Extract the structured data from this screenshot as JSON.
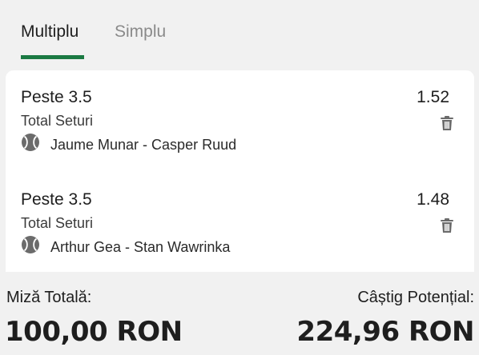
{
  "tabs": [
    {
      "label": "Multiplu",
      "active": true
    },
    {
      "label": "Simplu",
      "active": false
    }
  ],
  "colors": {
    "accent": "#1b7a43",
    "icon": "#6b6b6b"
  },
  "bets": [
    {
      "market": "Peste 3.5",
      "type": "Total Seturi",
      "event": "Jaume Munar - Casper Ruud",
      "odds": "1.52",
      "sport_icon": "tennis-ball-icon"
    },
    {
      "market": "Peste 3.5",
      "type": "Total Seturi",
      "event": "Arthur Gea - Stan Wawrinka",
      "odds": "1.48",
      "sport_icon": "tennis-ball-icon"
    }
  ],
  "totals": {
    "stake_label": "Miză Totală:",
    "stake_value": "100,00 RON",
    "win_label": "Câștig Potențial:",
    "win_value": "224,96 RON"
  }
}
